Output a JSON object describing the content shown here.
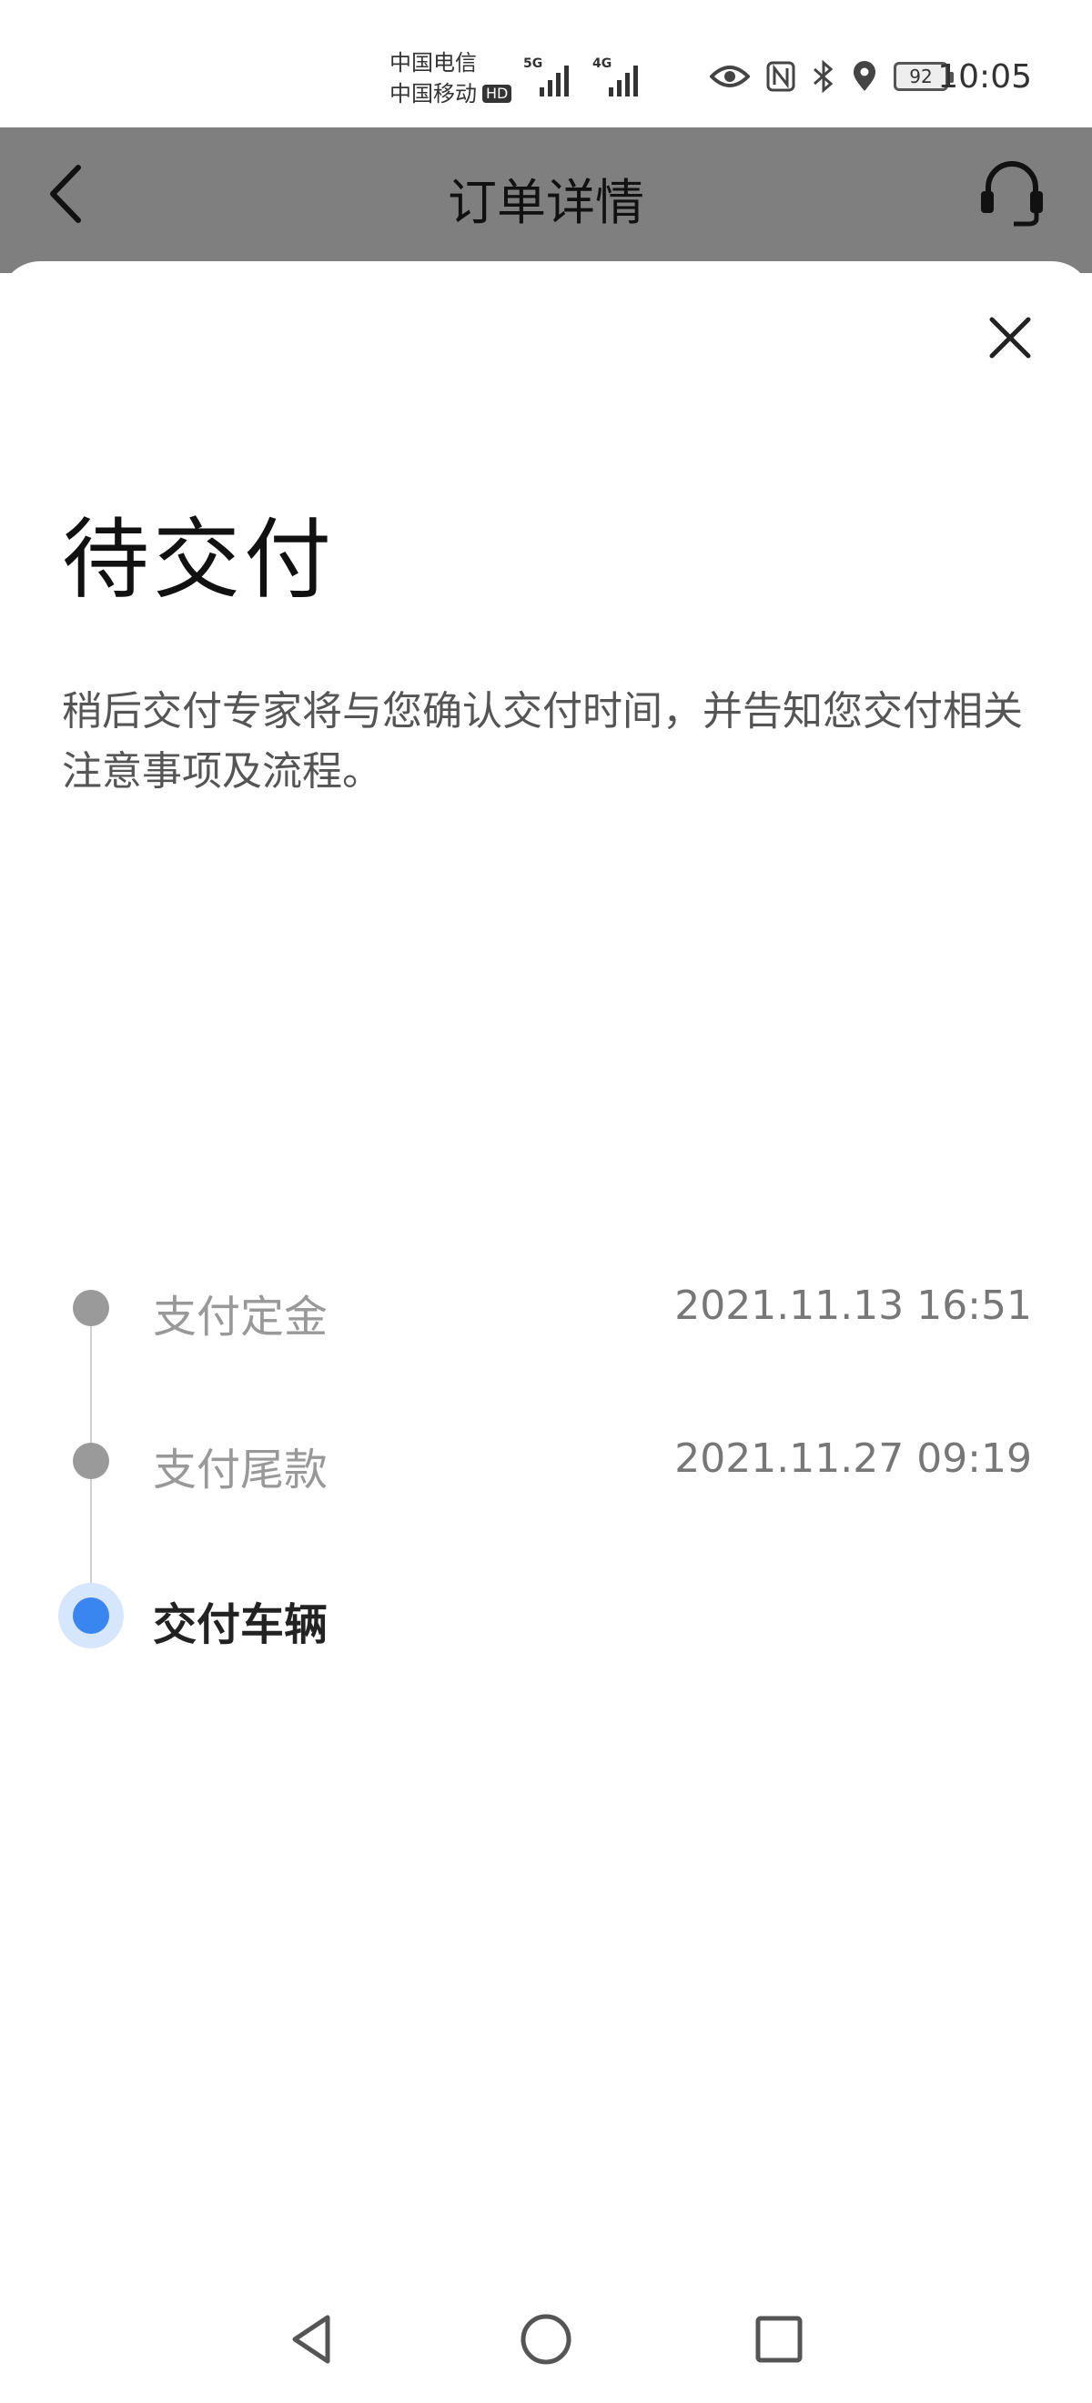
{
  "status_bar": {
    "carrier_1": "中国电信",
    "carrier_2": "中国移动",
    "hd_badge": "HD",
    "signal_1_tag": "5G",
    "signal_2_tag": "4G",
    "battery": "92",
    "time": "10:05"
  },
  "header": {
    "title": "订单详情"
  },
  "sheet": {
    "title": "待交付",
    "description": "稍后交付专家将与您确认交付时间，并告知您交付相关注意事项及流程。",
    "steps": [
      {
        "label": "支付定金",
        "time": "2021.11.13 16:51"
      },
      {
        "label": "支付尾款",
        "time": "2021.11.27 09:19"
      },
      {
        "label": "交付车辆",
        "time": ""
      }
    ]
  },
  "colors": {
    "accent": "#3a86f0",
    "overlay": "#7f7f7f"
  }
}
